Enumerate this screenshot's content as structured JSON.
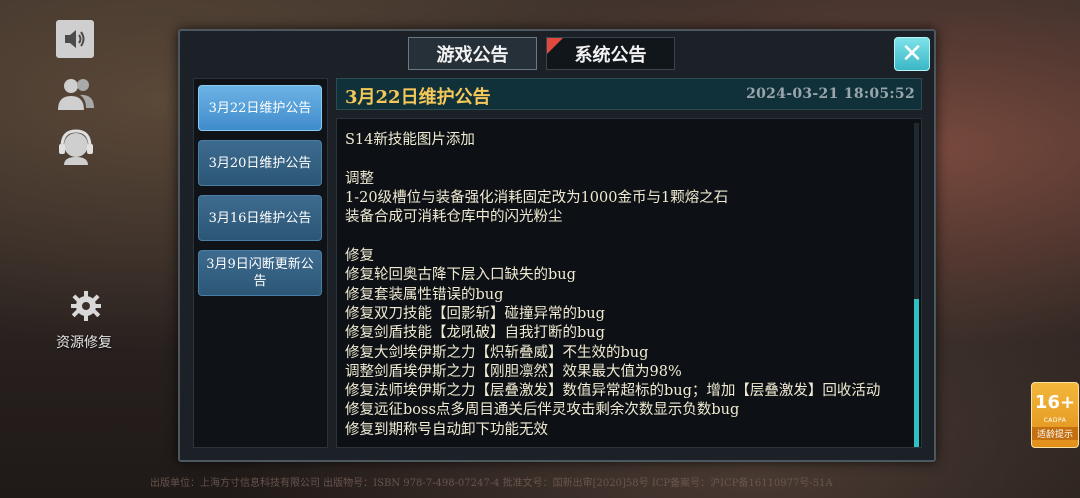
{
  "sidebar": {
    "resource_repair_label": "资源修复"
  },
  "tabs": [
    {
      "label": "游戏公告",
      "active": false
    },
    {
      "label": "系统公告",
      "active": true
    }
  ],
  "announcements": [
    {
      "label": "3月22日维护公告",
      "active": true
    },
    {
      "label": "3月20日维护公告",
      "active": false
    },
    {
      "label": "3月16日维护公告",
      "active": false
    },
    {
      "label": "3月9日闪断更新公告",
      "active": false
    }
  ],
  "detail": {
    "title": "3月22日维护公告",
    "timestamp": "2024-03-21  18:05:52",
    "lines": [
      "",
      "S14新技能图片添加",
      "",
      "调整",
      "1-20级槽位与装备强化消耗固定改为1000金币与1颗熔之石",
      "装备合成可消耗仓库中的闪光粉尘",
      "",
      "修复",
      "修复轮回奥古降下层入口缺失的bug",
      "修复套装属性错误的bug",
      "修复双刀技能【回影斩】碰撞异常的bug",
      "修复剑盾技能【龙吼破】自我打断的bug",
      "修复大剑埃伊斯之力【炽斩叠威】不生效的bug",
      "调整剑盾埃伊斯之力【刚胆凛然】效果最大值为98%",
      "修复法师埃伊斯之力【层叠激发】数值异常超标的bug；增加【层叠激发】回收活动",
      "修复远征boss点多周目通关后伴灵攻击剩余次数显示负数bug",
      "修复到期称号自动卸下功能无效"
    ]
  },
  "footer": "出版单位：上海方寸信息科技有限公司 出版物号：ISBN 978-7-498-07247-4 批准文号：国新出审[2020]58号 ICP备案号：沪ICP备16110977号-51A",
  "rating": {
    "age": "16+",
    "org": "CADPA",
    "tip": "适龄提示"
  },
  "colors": {
    "accent": "#2ec1c1",
    "title": "#f5c85a",
    "active_item": "#5aa5dd",
    "flag": "#e04a3c"
  }
}
